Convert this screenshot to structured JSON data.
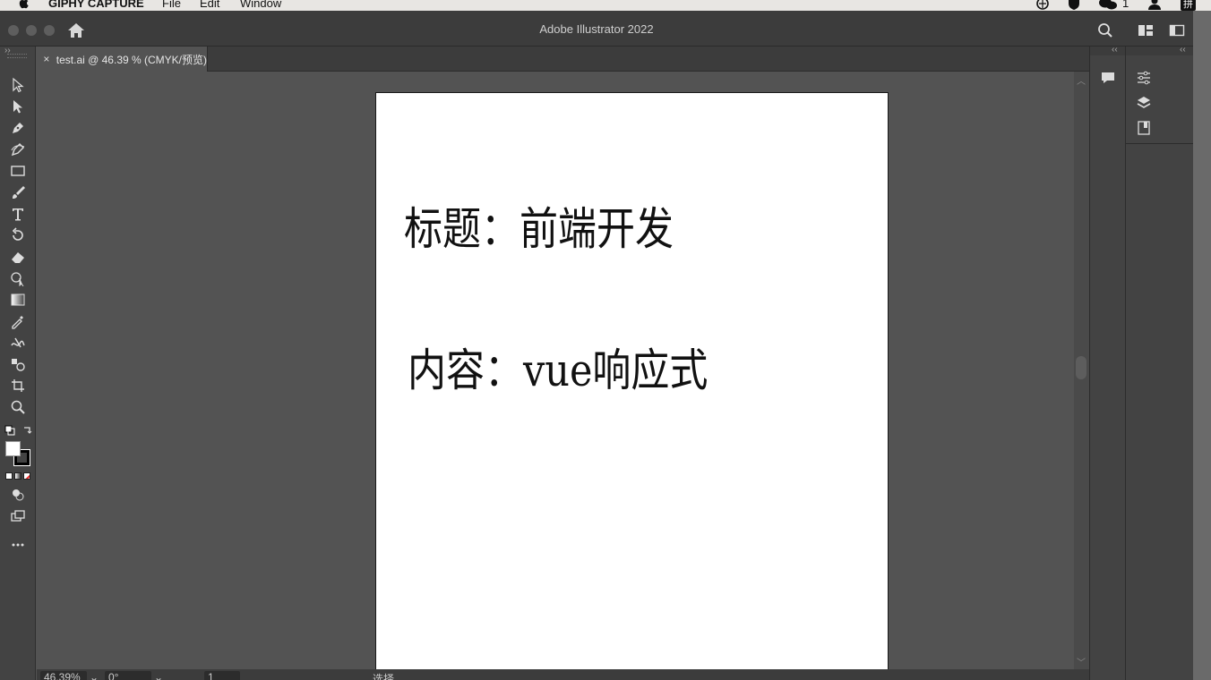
{
  "menubar": {
    "app_name": "GIPHY CAPTURE",
    "items": [
      "File",
      "Edit",
      "Window"
    ],
    "badge_count": "1",
    "input_method": "拼"
  },
  "window": {
    "title": "Adobe Illustrator 2022"
  },
  "document_tab": {
    "close": "×",
    "label": "test.ai @ 46.39 % (CMYK/预览)"
  },
  "artboard": {
    "heading": "标题：前端开发",
    "content": "内容：vue响应式"
  },
  "status": {
    "zoom": "46.39%",
    "rotation": "0°",
    "artboard_number": "1",
    "tool_hint": "选择"
  },
  "tools": [
    "selection-tool",
    "direct-selection-tool",
    "pen-tool",
    "curvature-tool",
    "rectangle-tool",
    "paintbrush-tool",
    "type-tool",
    "rotate-tool",
    "eraser-tool",
    "shape-builder-tool",
    "gradient-tool",
    "eyedropper-tool",
    "width-tool",
    "symbol-sprayer-tool",
    "artboard-tool",
    "zoom-tool"
  ],
  "colors": {
    "panel": "#434343",
    "chrome": "#3c3c3c",
    "canvas": "#535353",
    "artboard": "#ffffff"
  }
}
